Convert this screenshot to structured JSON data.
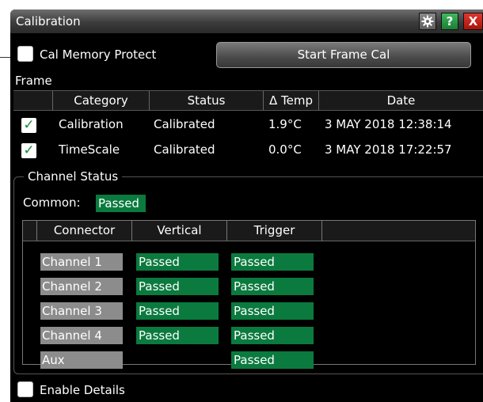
{
  "window": {
    "title": "Calibration",
    "buttons": {
      "gear": "gear-icon",
      "help": "?",
      "close": "X"
    }
  },
  "cal_memory_protect": {
    "label": "Cal Memory Protect",
    "checked": false
  },
  "start_frame_cal": {
    "label": "Start Frame Cal"
  },
  "frame": {
    "label": "Frame",
    "columns": [
      "Category",
      "Status",
      "Δ Temp",
      "Date"
    ],
    "rows": [
      {
        "checked": true,
        "category": "Calibration",
        "status": "Calibrated",
        "temp": "1.9°C",
        "date": "3 MAY 2018 12:38:14"
      },
      {
        "checked": true,
        "category": "TimeScale",
        "status": "Calibrated",
        "temp": "0.0°C",
        "date": "3 MAY 2018 17:22:57"
      }
    ]
  },
  "channel_status": {
    "title": "Channel Status",
    "common_label": "Common:",
    "common_value": "Passed",
    "columns": [
      "Connector",
      "Vertical",
      "Trigger"
    ],
    "rows": [
      {
        "connector": "Channel 1",
        "vertical": "Passed",
        "trigger": "Passed"
      },
      {
        "connector": "Channel 2",
        "vertical": "Passed",
        "trigger": "Passed"
      },
      {
        "connector": "Channel 3",
        "vertical": "Passed",
        "trigger": "Passed"
      },
      {
        "connector": "Channel 4",
        "vertical": "Passed",
        "trigger": "Passed"
      },
      {
        "connector": "Aux",
        "vertical": "",
        "trigger": "Passed"
      }
    ]
  },
  "enable_details": {
    "label": "Enable Details",
    "checked": false
  },
  "colors": {
    "passed": "#0b7a3e",
    "connector_bg": "#8c8c8c",
    "close_btn": "#c8201a",
    "help_btn": "#2a9a48"
  }
}
